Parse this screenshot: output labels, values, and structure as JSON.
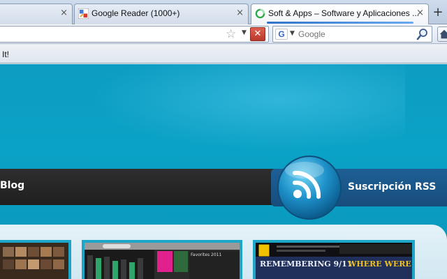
{
  "tabs": [
    {
      "title": "",
      "active": false
    },
    {
      "title": "Google Reader (1000+)",
      "active": false
    },
    {
      "title": "Soft & Apps – Software y Aplicaciones ...",
      "active": true
    }
  ],
  "tab_close_glyph": "×",
  "new_tab_glyph": "+",
  "navbar": {
    "url": "",
    "stop_glyph": "✕",
    "search_placeholder": "Google",
    "search_engine_logo": "G"
  },
  "bookmarks": {
    "items": [
      {
        "label": "It!"
      }
    ]
  },
  "page": {
    "nav_item": "Blog",
    "rss_label": "Suscripción RSS",
    "thumb2_title": "Favorites 2011",
    "thumb3_headline_a": "REMEMBERING 9/11",
    "thumb3_headline_b": "WHERE WERE YOU?"
  },
  "colors": {
    "page_bg": "#0aa2c6",
    "nav_strip": "#262626",
    "rss_tab": "#1b578a",
    "panel": "#dbedf5"
  },
  "icons": {
    "star": "star-icon",
    "stop": "stop-icon",
    "search": "magnifier-icon",
    "rss": "rss-icon",
    "new_tab": "plus-icon"
  }
}
